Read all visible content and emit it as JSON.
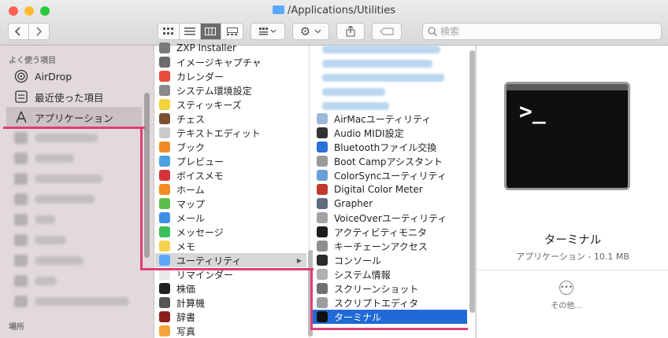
{
  "window": {
    "title": "/Applications/Utilities",
    "traffic_colors": [
      "#fe5f57",
      "#febc2e",
      "#28c840"
    ]
  },
  "toolbar": {
    "back_icon": "chevron-left-icon",
    "forward_icon": "chevron-right-icon",
    "view_icons": [
      "icon-view-icon",
      "list-view-icon",
      "column-view-icon",
      "gallery-view-icon"
    ],
    "active_view_index": 2,
    "group_icon": "group-icon",
    "action_icon": "gear-icon",
    "share_icon": "share-icon",
    "tags_icon": "tag-icon",
    "search_placeholder": "検索"
  },
  "sidebar": {
    "favorites_header": "よく使う項目",
    "items": [
      {
        "label": "AirDrop",
        "icon": "airdrop-icon"
      },
      {
        "label": "最近使った項目",
        "icon": "recents-icon"
      },
      {
        "label": "アプリケーション",
        "icon": "applications-icon",
        "selected": true
      }
    ],
    "locations_header": "場所"
  },
  "apps_column": [
    {
      "label": "ZXP Installer",
      "color": "#7a7a7a"
    },
    {
      "label": "イメージキャプチャ",
      "color": "#6b6b6b"
    },
    {
      "label": "カレンダー",
      "color": "#e84c3d"
    },
    {
      "label": "システム環境設定",
      "color": "#8a8a8a"
    },
    {
      "label": "スティッキーズ",
      "color": "#f2d33d"
    },
    {
      "label": "チェス",
      "color": "#7a5230"
    },
    {
      "label": "テキストエディット",
      "color": "#c9c9c9"
    },
    {
      "label": "ブック",
      "color": "#f08a24"
    },
    {
      "label": "プレビュー",
      "color": "#4aa3df"
    },
    {
      "label": "ボイスメモ",
      "color": "#d6343a"
    },
    {
      "label": "ホーム",
      "color": "#f28c1e"
    },
    {
      "label": "マップ",
      "color": "#5cbf4a"
    },
    {
      "label": "メール",
      "color": "#3d8ee8"
    },
    {
      "label": "メッセージ",
      "color": "#3bbf5c"
    },
    {
      "label": "メモ",
      "color": "#f7d24c"
    },
    {
      "label": "ユーティリティ",
      "color": "#5aa9ff",
      "highlighted": true,
      "folder": true
    },
    {
      "label": "リマインダー",
      "color": "#e8e8e8"
    },
    {
      "label": "株価",
      "color": "#222222"
    },
    {
      "label": "計算機",
      "color": "#555555"
    },
    {
      "label": "辞書",
      "color": "#8b1d1d"
    },
    {
      "label": "写真",
      "color": "#f4a23a"
    }
  ],
  "utilities_column": [
    {
      "label": "AirMacユーティリティ",
      "color": "#9bb8d8"
    },
    {
      "label": "Audio MIDI設定",
      "color": "#333333"
    },
    {
      "label": "Bluetoothファイル交換",
      "color": "#2a6fdb"
    },
    {
      "label": "Boot Campアシスタント",
      "color": "#9a9a9a"
    },
    {
      "label": "ColorSyncユーティリティ",
      "color": "#6aa0d8"
    },
    {
      "label": "Digital Color Meter",
      "color": "#c0392b"
    },
    {
      "label": "Grapher",
      "color": "#5d6d7e"
    },
    {
      "label": "VoiceOverユーティリティ",
      "color": "#a3a3a3"
    },
    {
      "label": "アクティビティモニタ",
      "color": "#1e1e1e"
    },
    {
      "label": "キーチェーンアクセス",
      "color": "#8e8e8e"
    },
    {
      "label": "コンソール",
      "color": "#2b2b2b"
    },
    {
      "label": "システム情報",
      "color": "#b0b0b0"
    },
    {
      "label": "スクリーンショット",
      "color": "#707070"
    },
    {
      "label": "スクリプトエディタ",
      "color": "#9c9c9c"
    },
    {
      "label": "ターミナル",
      "color": "#111111",
      "selected": true
    }
  ],
  "preview": {
    "name": "ターミナル",
    "kind": "アプリケーション - 10.1 MB",
    "prompt": ">_",
    "more_label": "その他..."
  }
}
